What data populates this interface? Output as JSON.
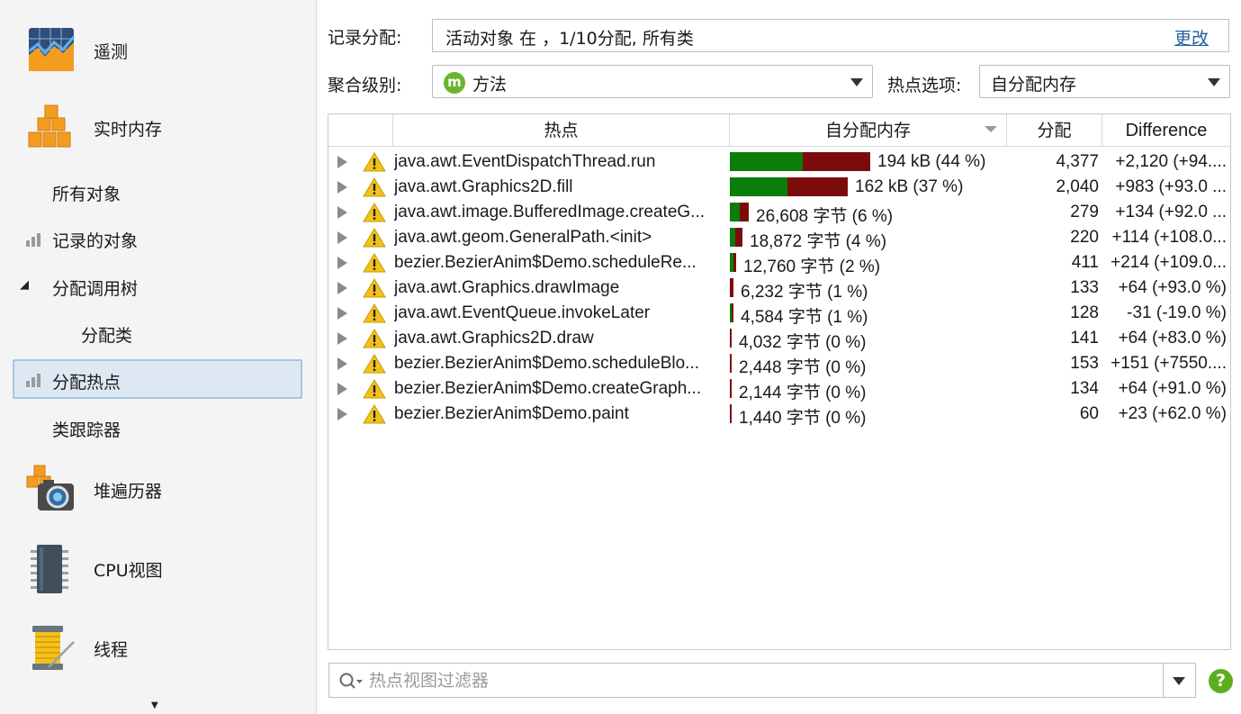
{
  "sidebar": {
    "sections": [
      {
        "label": "遥测",
        "icon": "telemetry-icon"
      },
      {
        "label": "实时内存",
        "icon": "live-memory-icon"
      },
      {
        "label": "堆遍历器",
        "icon": "heap-walker-icon"
      },
      {
        "label": "CPU视图",
        "icon": "cpu-chip-icon"
      },
      {
        "label": "线程",
        "icon": "thread-spool-icon"
      }
    ],
    "items": [
      {
        "label": "所有对象"
      },
      {
        "label": "记录的对象"
      },
      {
        "label": "分配调用树"
      },
      {
        "label": "分配类"
      },
      {
        "label": "分配热点",
        "selected": true
      },
      {
        "label": "类跟踪器"
      }
    ]
  },
  "controls": {
    "recording_label": "记录分配:",
    "recording_value": "活动对象 在 ，1/10分配, 所有类",
    "change_link": "更改",
    "aggregation_label": "聚合级别:",
    "aggregation_value": "方法",
    "hotspot_label": "热点选项:",
    "hotspot_value": "自分配内存"
  },
  "table": {
    "columns": [
      "热点",
      "自分配内存",
      "分配",
      "Difference"
    ],
    "sorted_column": "自分配内存",
    "rows": [
      {
        "method": "java.awt.EventDispatchThread.run",
        "mem": "194 kB (44 %)",
        "alloc": "4,377",
        "diff": "+2,120 (+94....",
        "green_frac": 0.52,
        "pct": 44
      },
      {
        "method": "java.awt.Graphics2D.fill",
        "mem": "162 kB (37 %)",
        "alloc": "2,040",
        "diff": "+983 (+93.0 ...",
        "green_frac": 0.49,
        "pct": 37
      },
      {
        "method": "java.awt.image.BufferedImage.createG...",
        "mem": "26,608 字节 (6 %)",
        "alloc": "279",
        "diff": "+134 (+92.0 ...",
        "green_frac": 0.5,
        "pct": 6
      },
      {
        "method": "java.awt.geom.GeneralPath.<init>",
        "mem": "18,872 字节 (4 %)",
        "alloc": "220",
        "diff": "+114 (+108.0...",
        "green_frac": 0.45,
        "pct": 4
      },
      {
        "method": "bezier.BezierAnim$Demo.scheduleRe...",
        "mem": "12,760 字节 (2 %)",
        "alloc": "411",
        "diff": "+214 (+109.0...",
        "green_frac": 0.55,
        "pct": 2
      },
      {
        "method": "java.awt.Graphics.drawImage",
        "mem": "6,232 字节 (1 %)",
        "alloc": "133",
        "diff": "+64 (+93.0 %)",
        "green_frac": 0.0,
        "pct": 1
      },
      {
        "method": "java.awt.EventQueue.invokeLater",
        "mem": "4,584 字节 (1 %)",
        "alloc": "128",
        "diff": "-31 (-19.0 %)",
        "green_frac": 0.6,
        "pct": 1
      },
      {
        "method": "java.awt.Graphics2D.draw",
        "mem": "4,032 字节 (0 %)",
        "alloc": "141",
        "diff": "+64 (+83.0 %)",
        "green_frac": 0.0,
        "pct": 0.5
      },
      {
        "method": "bezier.BezierAnim$Demo.scheduleBlo...",
        "mem": "2,448 字节 (0 %)",
        "alloc": "153",
        "diff": "+151 (+7550....",
        "green_frac": 0.0,
        "pct": 0.4
      },
      {
        "method": "bezier.BezierAnim$Demo.createGraph...",
        "mem": "2,144 字节 (0 %)",
        "alloc": "134",
        "diff": "+64 (+91.0 %)",
        "green_frac": 0.0,
        "pct": 0
      },
      {
        "method": "bezier.BezierAnim$Demo.paint",
        "mem": "1,440 字节 (0 %)",
        "alloc": "60",
        "diff": "+23 (+62.0 %)",
        "green_frac": 0.0,
        "pct": 0
      }
    ]
  },
  "filter": {
    "placeholder": "热点视图过滤器"
  },
  "help": "?",
  "colors": {
    "bar_green": "#0a7d0a",
    "bar_red": "#7c0c0c",
    "selection": "#dde8f3",
    "link": "#1f5fa6",
    "help_green": "#5cae1f"
  }
}
